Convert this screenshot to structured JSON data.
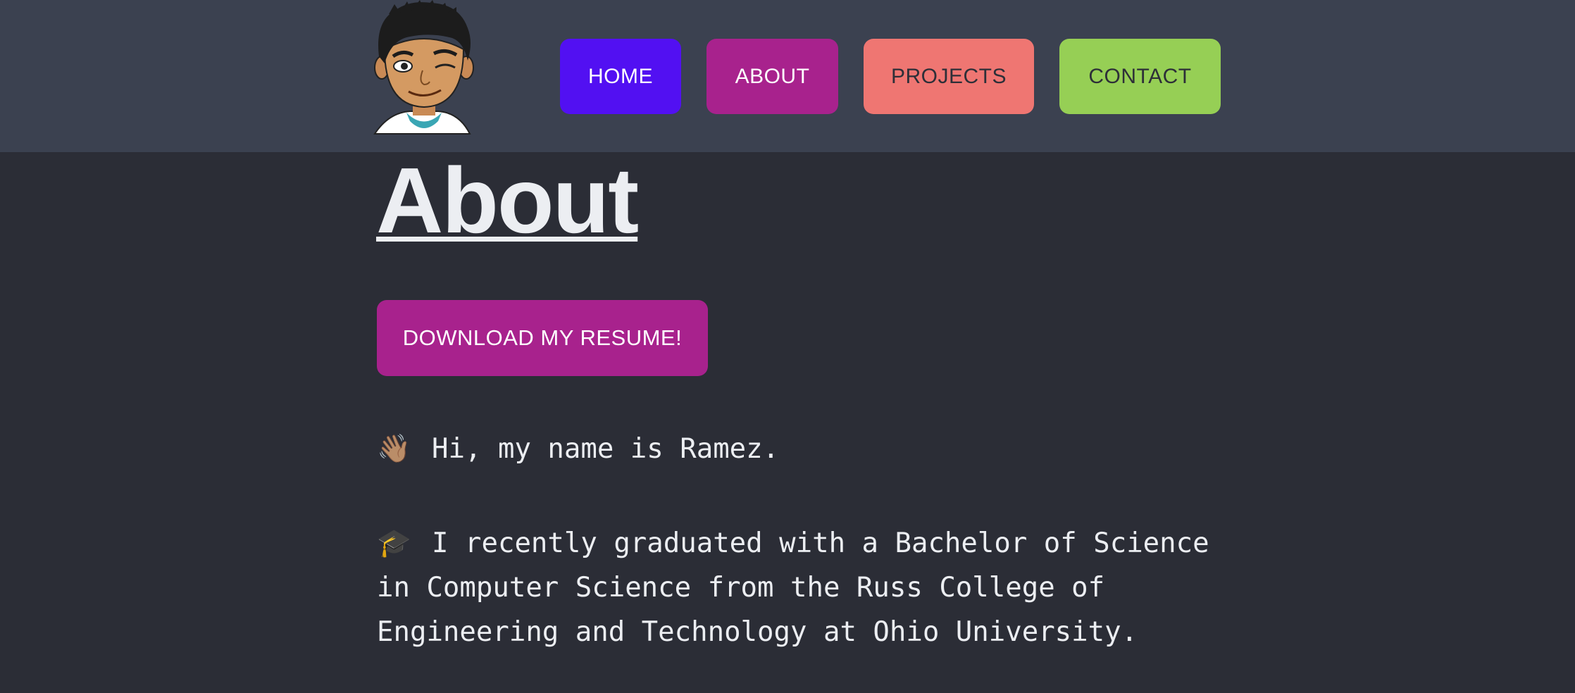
{
  "nav": {
    "avatar_alt": "Bitmoji avatar",
    "items": [
      {
        "label": "HOME",
        "color": "#5210f2"
      },
      {
        "label": "ABOUT",
        "color": "#a8228d"
      },
      {
        "label": "PROJECTS",
        "color": "#ef7672"
      },
      {
        "label": "CONTACT",
        "color": "#96cf55"
      }
    ]
  },
  "main": {
    "title": "About",
    "resume_button": "DOWNLOAD MY RESUME!",
    "paragraphs": [
      {
        "emoji": "👋🏽",
        "icon": "waving-hand-icon",
        "text": "Hi, my name is Ramez."
      },
      {
        "emoji": "🎓",
        "icon": "graduation-cap-icon",
        "text": "I recently graduated with a Bachelor of Science in Computer Science from the Russ College of Engineering and Technology at Ohio University."
      }
    ]
  },
  "colors": {
    "background": "#2b2d36",
    "header": "#3b4150",
    "text": "#eceef2"
  }
}
